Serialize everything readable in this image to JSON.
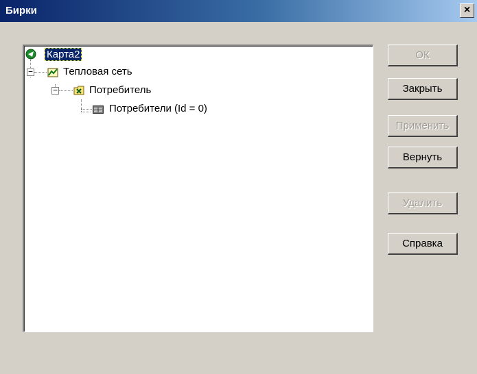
{
  "window": {
    "title": "Бирки",
    "close_glyph": "×"
  },
  "tree": {
    "nodes": [
      {
        "label": "Карта2",
        "icon": "map-icon",
        "selected": true
      },
      {
        "label": "Тепловая сеть",
        "icon": "network-icon",
        "expander": "−"
      },
      {
        "label": "Потребитель",
        "icon": "folder-icon",
        "expander": "−"
      },
      {
        "label": "Потребители (Id = 0)",
        "icon": "table-icon"
      }
    ]
  },
  "buttons": {
    "ok": "ОК",
    "close": "Закрыть",
    "apply": "Применить",
    "revert": "Вернуть",
    "delete": "Удалить",
    "help": "Справка"
  }
}
